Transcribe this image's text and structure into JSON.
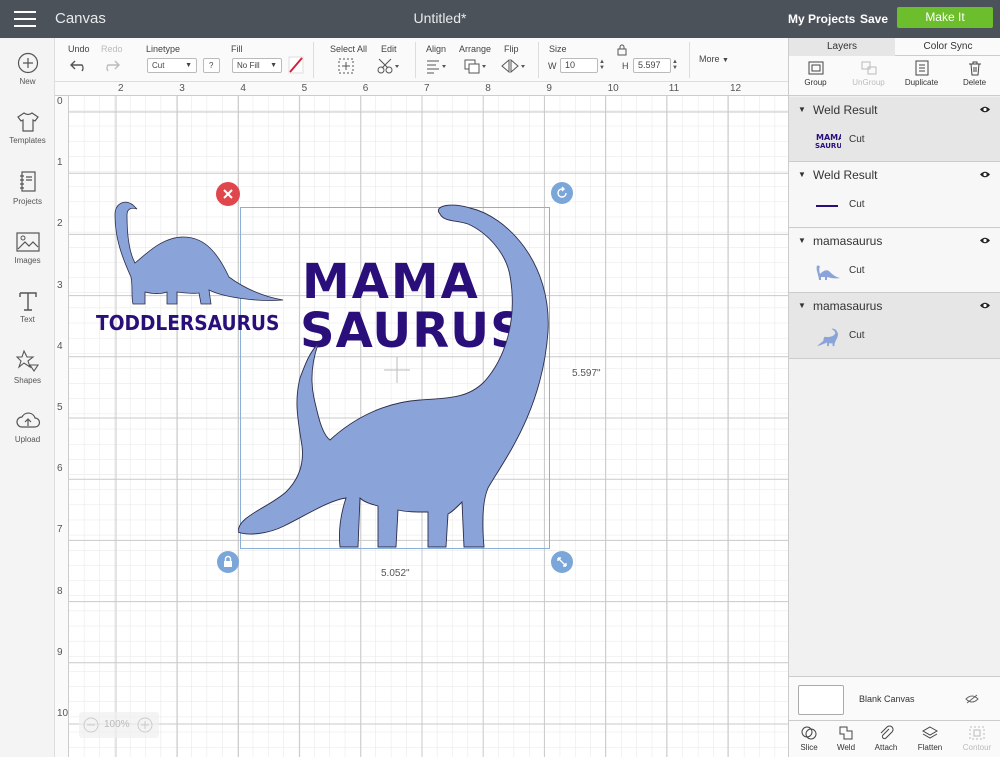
{
  "header": {
    "app_title": "Canvas",
    "doc_title": "Untitled*",
    "my_projects": "My Projects",
    "save": "Save",
    "make_it": "Make It"
  },
  "toolbar": {
    "undo": "Undo",
    "redo": "Redo",
    "linetype_label": "Linetype",
    "linetype_value": "Cut",
    "help": "?",
    "fill_label": "Fill",
    "fill_value": "No Fill",
    "select_all": "Select All",
    "edit": "Edit",
    "align": "Align",
    "arrange": "Arrange",
    "flip": "Flip",
    "size_label": "Size",
    "w_label": "W",
    "w_value": "10",
    "h_label": "H",
    "h_value": "5.597",
    "more": "More"
  },
  "sidebar": {
    "items": [
      {
        "label": "New",
        "icon": "plus-circle-icon"
      },
      {
        "label": "Templates",
        "icon": "tshirt-icon"
      },
      {
        "label": "Projects",
        "icon": "notebook-icon"
      },
      {
        "label": "Images",
        "icon": "image-icon"
      },
      {
        "label": "Text",
        "icon": "text-t-icon"
      },
      {
        "label": "Shapes",
        "icon": "shapes-icon"
      },
      {
        "label": "Upload",
        "icon": "cloud-upload-icon"
      }
    ]
  },
  "canvas": {
    "ruler_top": [
      "2",
      "3",
      "4",
      "5",
      "6",
      "7",
      "8",
      "9",
      "10",
      "11",
      "12"
    ],
    "ruler_left": [
      "0",
      "1",
      "2",
      "3",
      "4",
      "5",
      "6",
      "7",
      "8",
      "9",
      "10"
    ],
    "design_text_main_1": "MAMA",
    "design_text_main_2": "SAURUS",
    "design_text_small": "TODDLERSAURUS",
    "height_readout": "5.597\"",
    "width_readout": "5.052\"",
    "zoom": "100%"
  },
  "colors": {
    "dino": "#8aa3d8",
    "text_purple": "#2a0f7a",
    "accent_green": "#6dbe2c",
    "delete_red": "#e0474c",
    "handle_blue": "#7aa6d9"
  },
  "panel": {
    "tab_layers": "Layers",
    "tab_color_sync": "Color Sync",
    "actions": {
      "group": "Group",
      "ungroup": "UnGroup",
      "duplicate": "Duplicate",
      "delete": "Delete"
    },
    "layers": [
      {
        "name": "Weld Result",
        "operation": "Cut",
        "thumb": "mamasaurus-text-thumb"
      },
      {
        "name": "Weld Result",
        "operation": "Cut",
        "thumb": "line-thumb"
      },
      {
        "name": "mamasaurus",
        "operation": "Cut",
        "thumb": "small-dino-thumb"
      },
      {
        "name": "mamasaurus",
        "operation": "Cut",
        "thumb": "dino-thumb"
      }
    ],
    "blank_canvas": "Blank Canvas",
    "bottom_actions": {
      "slice": "Slice",
      "weld": "Weld",
      "attach": "Attach",
      "flatten": "Flatten",
      "contour": "Contour"
    }
  }
}
